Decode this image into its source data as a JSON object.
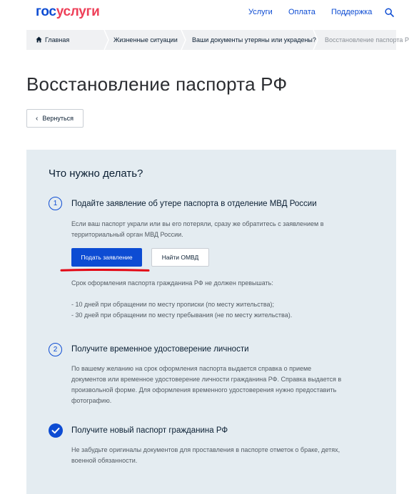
{
  "header": {
    "logo_part1": "гос",
    "logo_part2": "услуги",
    "nav": {
      "services": "Услуги",
      "payment": "Оплата",
      "support": "Поддержка"
    }
  },
  "breadcrumb": {
    "home": "Главная",
    "life": "Жизненные ситуации",
    "lost": "Ваши документы утеряны или украдены?",
    "current": "Восстановление паспорта РФ"
  },
  "page": {
    "title": "Восстановление паспорта РФ",
    "back_label": "Вернуться"
  },
  "panel": {
    "title": "Что нужно делать?",
    "steps": [
      {
        "number": "1",
        "title": "Подайте заявление об утере паспорта в отделение МВД России",
        "lines": [
          "Если ваш паспорт украли или вы его потеряли, сразу же обратитесь с заявлением в",
          "территориальный орган МВД России."
        ],
        "primary_button": "Подать заявление",
        "secondary_button": "Найти ОМВД",
        "term_text": "Срок оформления паспорта гражданина РФ не должен превышать:",
        "term_items": [
          "- 10 дней при обращении по месту прописки (по месту жительства);",
          "- 30 дней при обращении по месту пребывания (не по месту жительства)."
        ]
      },
      {
        "number": "2",
        "title": "Получите временное удостоверение личности",
        "lines": [
          "По вашему желанию на срок оформления паспорта выдается справка о приеме",
          "документов или временное удостоверение личности гражданина РФ. Справка выдается в",
          "произвольной форме. Для оформления временного удостоверения нужно предоставить",
          "фотографию."
        ]
      },
      {
        "title": "Получите новый паспорт гражданина РФ",
        "lines": [
          "Не забудьте оригиналы документов для проставления в паспорте отметок о браке, детях,",
          "военной обязанности."
        ]
      }
    ]
  },
  "colors": {
    "brand_blue": "#0d4cd3",
    "brand_red": "#ee3f58",
    "panel_bg": "#e4ecf1",
    "highlight_red": "#e30613"
  }
}
